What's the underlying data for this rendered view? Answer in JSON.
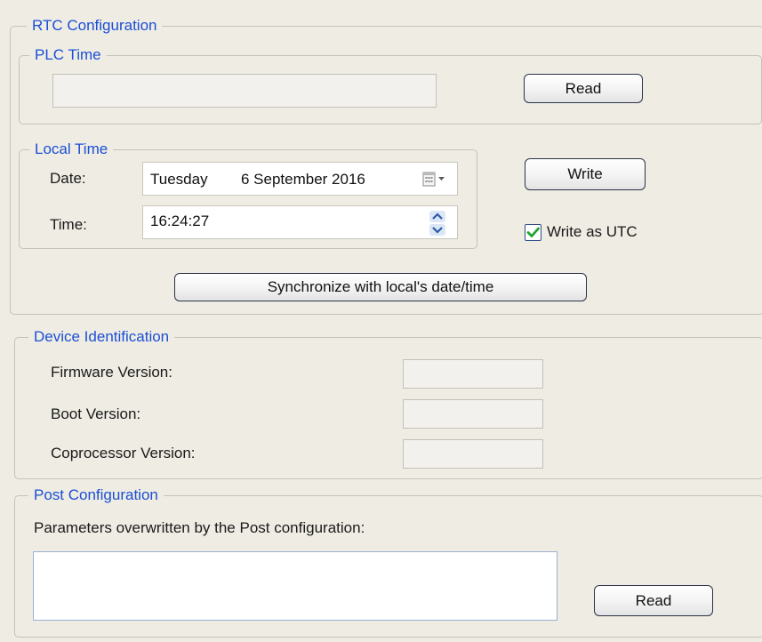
{
  "rtc": {
    "legend": "RTC Configuration",
    "plc_time": {
      "legend": "PLC Time",
      "value": "",
      "read_label": "Read"
    },
    "local_time": {
      "legend": "Local Time",
      "date_label": "Date:",
      "date_weekday": "Tuesday",
      "date_value": "6 September 2016",
      "time_label": "Time:",
      "time_value": "16:24:27"
    },
    "write_label": "Write",
    "write_utc_label": "Write as UTC",
    "write_utc_checked": true,
    "sync_label": "Synchronize with local's date/time"
  },
  "device": {
    "legend": "Device Identification",
    "firmware_label": "Firmware Version:",
    "firmware_value": "",
    "boot_label": "Boot Version:",
    "boot_value": "",
    "coprocessor_label": "Coprocessor Version:",
    "coprocessor_value": ""
  },
  "post": {
    "legend": "Post Configuration",
    "description": "Parameters overwritten by the Post configuration:",
    "list_value": "",
    "read_label": "Read"
  },
  "colors": {
    "legend_blue": "#1b4fd6",
    "check_green": "#1fa52a"
  },
  "icons": {
    "calendar": "calendar-dropdown-icon",
    "spinner": "spinner-up-down-icon",
    "check": "checkmark-icon"
  }
}
